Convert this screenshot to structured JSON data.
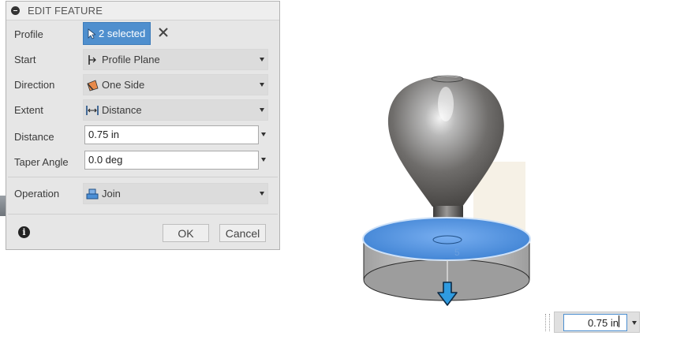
{
  "dialog": {
    "title": "EDIT FEATURE",
    "profile": {
      "label": "Profile",
      "selection": "2 selected"
    },
    "start": {
      "label": "Start",
      "value": "Profile Plane"
    },
    "direction": {
      "label": "Direction",
      "value": "One Side"
    },
    "extent": {
      "label": "Extent",
      "value": "Distance"
    },
    "distance": {
      "label": "Distance",
      "value": "0.75 in"
    },
    "taper": {
      "label": "Taper Angle",
      "value": "0.0 deg"
    },
    "operation": {
      "label": "Operation",
      "value": "Join"
    },
    "ok_label": "OK",
    "cancel_label": "Cancel"
  },
  "viewport": {
    "dimension_hint": "5",
    "distance_input": "0.75 in"
  },
  "colors": {
    "selection_blue": "#4f8fce",
    "dialog_bg": "#e6e6e6",
    "model_face_blue": "#4b8fd6"
  }
}
